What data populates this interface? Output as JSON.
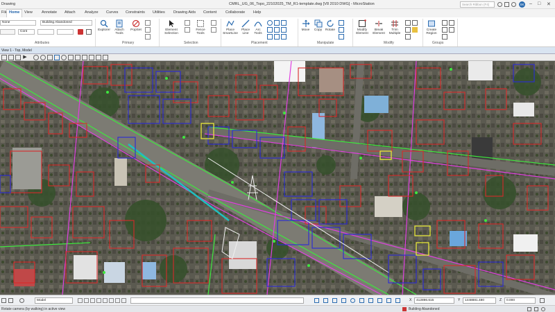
{
  "titlebar": {
    "workspace": "Drawing",
    "document_title": "CMRL_UG_06_Topo_22102025_TM_R1-template.dwg [V8 2010 DWG] - MicroStation",
    "search_placeholder": "Search Ribbon (F4)",
    "user_initials": "SK"
  },
  "ribbon_tabs": [
    "File",
    "Home",
    "View",
    "Annotate",
    "Attach",
    "Analyze",
    "Curves",
    "Constraints",
    "Utilities",
    "Drawing Aids",
    "Content",
    "Collaborate",
    "Help"
  ],
  "active_tab": "Home",
  "ribbon": {
    "attributes": {
      "label": "Attributes",
      "color_value": "None",
      "level_value": "Building Abandoned",
      "linestyle_value": "Cont"
    },
    "primary": {
      "label": "Primary",
      "buttons": [
        "Explorer",
        "Attach Tools",
        "PopSet"
      ]
    },
    "selection": {
      "label": "Selection",
      "buttons": [
        "Element Selection",
        "Fence Tools"
      ]
    },
    "placement": {
      "label": "Placement",
      "buttons": [
        "Place SmartLine",
        "Place Line",
        "Arc Tools"
      ]
    },
    "manipulate": {
      "label": "Manipulate",
      "buttons": [
        "Move",
        "Copy",
        "Rotate"
      ]
    },
    "modify": {
      "label": "Modify",
      "buttons": [
        "Modify Element",
        "Break Element",
        "Trim Multiple"
      ]
    },
    "groups": {
      "label": "Groups",
      "buttons": [
        "Create Region"
      ]
    }
  },
  "view": {
    "title": "View 1 - Top, Model"
  },
  "statusbar": {
    "model": "Model",
    "x_coord": "412896.615",
    "y_coord": "1448881.480",
    "z_coord": "0.000",
    "prompt": "Rotate camera (by walking) in active view",
    "level": "Building Abandoned"
  },
  "colors": {
    "accent": "#1c5fa8",
    "building_outline": "#d82a2a",
    "parcel_outline": "#2a2ad8",
    "road_line": "#3ee83e",
    "boundary_line": "#e040e0",
    "highlight": "#e8e83a"
  }
}
